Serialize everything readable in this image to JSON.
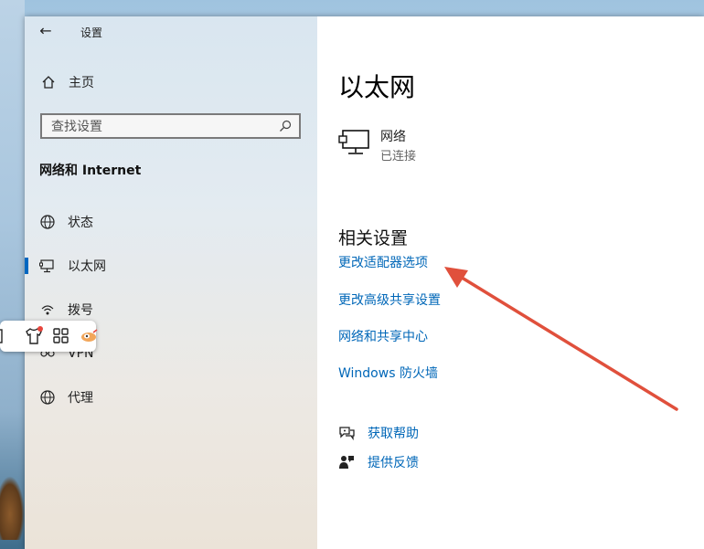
{
  "window": {
    "title": "设置"
  },
  "sidebar": {
    "home_label": "主页",
    "search_placeholder": "查找设置",
    "section_title": "网络和 Internet",
    "items": [
      {
        "label": "状态",
        "icon": "globe-status-icon"
      },
      {
        "label": "以太网",
        "icon": "ethernet-icon",
        "selected": true
      },
      {
        "label": "拨号",
        "icon": "dialup-icon"
      },
      {
        "label": "VPN",
        "icon": "vpn-icon"
      },
      {
        "label": "代理",
        "icon": "proxy-globe-icon"
      }
    ]
  },
  "main": {
    "title": "以太网",
    "network": {
      "name": "网络",
      "status": "已连接"
    },
    "related_title": "相关设置",
    "links": [
      "更改适配器选项",
      "更改高级共享设置",
      "网络和共享中心",
      "Windows 防火墙"
    ],
    "help": [
      {
        "label": "获取帮助",
        "icon": "help-chat-icon"
      },
      {
        "label": "提供反馈",
        "icon": "feedback-icon"
      }
    ]
  },
  "colors": {
    "accent": "#0067c0",
    "link": "#0067b8",
    "annotation_arrow": "#e0503c"
  }
}
